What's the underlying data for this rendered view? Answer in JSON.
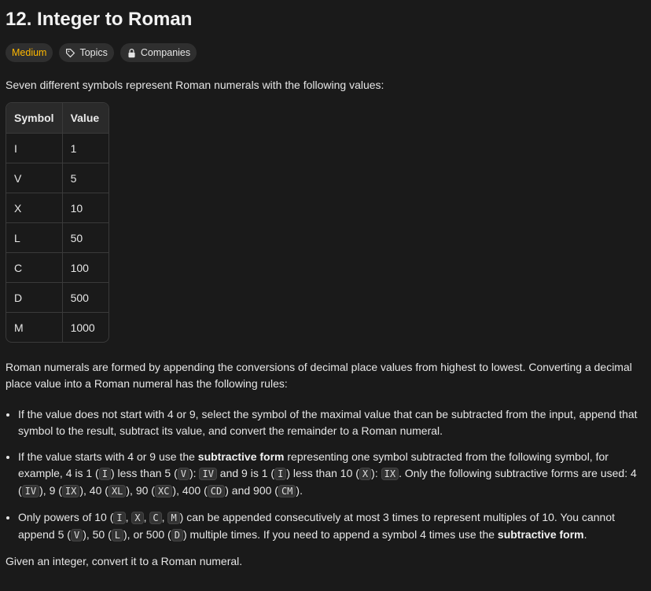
{
  "title": "12. Integer to Roman",
  "tags": {
    "difficulty": "Medium",
    "topics": "Topics",
    "companies": "Companies"
  },
  "intro": "Seven different symbols represent Roman numerals with the following values:",
  "table": {
    "headers": [
      "Symbol",
      "Value"
    ],
    "rows": [
      [
        "I",
        "1"
      ],
      [
        "V",
        "5"
      ],
      [
        "X",
        "10"
      ],
      [
        "L",
        "50"
      ],
      [
        "C",
        "100"
      ],
      [
        "D",
        "500"
      ],
      [
        "M",
        "1000"
      ]
    ]
  },
  "para": "Roman numerals are formed by appending the conversions of decimal place values from highest to lowest. Converting a decimal place value into a Roman numeral has the following rules:",
  "bullets": {
    "b1": "If the value does not start with 4 or 9, select the symbol of the maximal value that can be subtracted from the input, append that symbol to the result, subtract its value, and convert the remainder to a Roman numeral.",
    "b2": {
      "t1": "If the value starts with 4 or 9 use the ",
      "bold": "subtractive form",
      "t2": " representing one symbol subtracted from the following symbol, for example, 4 is 1 (",
      "c1": "I",
      "t3": ") less than 5 (",
      "c2": "V",
      "t4": "): ",
      "c3": "IV",
      "t5": " and 9 is 1 (",
      "c4": "I",
      "t6": ") less than 10 (",
      "c5": "X",
      "t7": "): ",
      "c6": "IX",
      "t8": ". Only the following subtractive forms are used: 4 (",
      "c7": "IV",
      "t9": "), 9 (",
      "c8": "IX",
      "t10": "), 40 (",
      "c9": "XL",
      "t11": "), 90 (",
      "c10": "XC",
      "t12": "), 400 (",
      "c11": "CD",
      "t13": ") and 900 (",
      "c12": "CM",
      "t14": ")."
    },
    "b3": {
      "t1": "Only powers of 10 (",
      "c1": "I",
      "s1": ", ",
      "c2": "X",
      "s2": ", ",
      "c3": "C",
      "s3": ", ",
      "c4": "M",
      "t2": ") can be appended consecutively at most 3 times to represent multiples of 10. You cannot append 5 (",
      "c5": "V",
      "t3": "), 50 (",
      "c6": "L",
      "t4": "), or 500 (",
      "c7": "D",
      "t5": ") multiple times. If you need to append a symbol 4 times use the ",
      "bold": "subtractive form",
      "t6": "."
    }
  },
  "final": "Given an integer, convert it to a Roman numeral.",
  "colors": {
    "background": "#1a1a1a",
    "medium": "#ffb800",
    "tag_bg": "#2f2f2f"
  }
}
